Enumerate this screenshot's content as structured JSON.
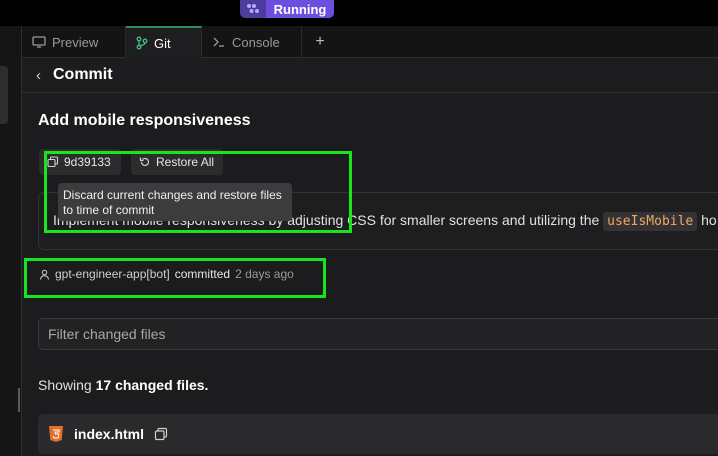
{
  "status": {
    "label": "Running"
  },
  "tabs": {
    "preview": "Preview",
    "git": "Git",
    "console": "Console",
    "add": "+"
  },
  "header": {
    "back": "‹",
    "title": "Commit"
  },
  "commit": {
    "title": "Add mobile responsiveness",
    "hash": "9d39133",
    "restore_label": "Restore All",
    "tooltip": "Discard current changes and restore files to time of commit",
    "description_prefix": "Implement mobile responsiveness by adjusting CSS for smaller screens and utilizing the",
    "description_code": "useIsMobile",
    "description_suffix": "ho",
    "author": "gpt-engineer-app[bot]",
    "committed_label": "committed",
    "when": "2 days ago"
  },
  "filter": {
    "placeholder": "Filter changed files"
  },
  "summary": {
    "prefix": "Showing",
    "count": "17",
    "suffix": "changed files."
  },
  "files": [
    {
      "name": "index.html"
    }
  ],
  "colors": {
    "accent_running": "#6d4fe0",
    "highlight": "#17e51d",
    "git_tab": "#2e8b57",
    "html_icon": "#e36f2c"
  }
}
